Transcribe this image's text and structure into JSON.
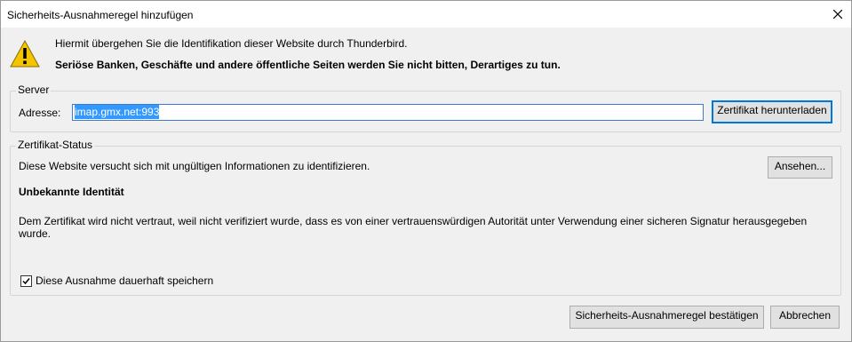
{
  "window": {
    "title": "Sicherheits-Ausnahmeregel hinzufügen",
    "close_icon": "close-icon"
  },
  "intro": {
    "icon": "warning-icon",
    "line1": "Hiermit übergehen Sie die Identifikation dieser Website durch Thunderbird.",
    "line2": "Seriöse Banken, Geschäfte und andere öffentliche Seiten werden Sie nicht bitten, Derartiges zu tun."
  },
  "server": {
    "legend": "Server",
    "address_label": "Adresse:",
    "address_value": "imap.gmx.net:993",
    "download_button": "Zertifikat herunterladen"
  },
  "certificate_status": {
    "legend": "Zertifikat-Status",
    "summary": "Diese Website versucht sich mit ungültigen Informationen zu identifizieren.",
    "view_button": "Ansehen...",
    "heading": "Unbekannte Identität",
    "detail": "Dem Zertifikat wird nicht vertraut, weil nicht verifiziert wurde, dass es von einer vertrauenswürdigen Autorität unter Verwendung einer sicheren Signatur herausgegeben wurde.",
    "permanent_checkbox_label": "Diese Ausnahme dauerhaft speichern",
    "permanent_checked": true
  },
  "actions": {
    "confirm_button": "Sicherheits-Ausnahmeregel bestätigen",
    "cancel_button": "Abbrechen"
  },
  "colors": {
    "accent": "#0078d7",
    "selection": "#3399ff",
    "warning_yellow": "#f5c400"
  }
}
